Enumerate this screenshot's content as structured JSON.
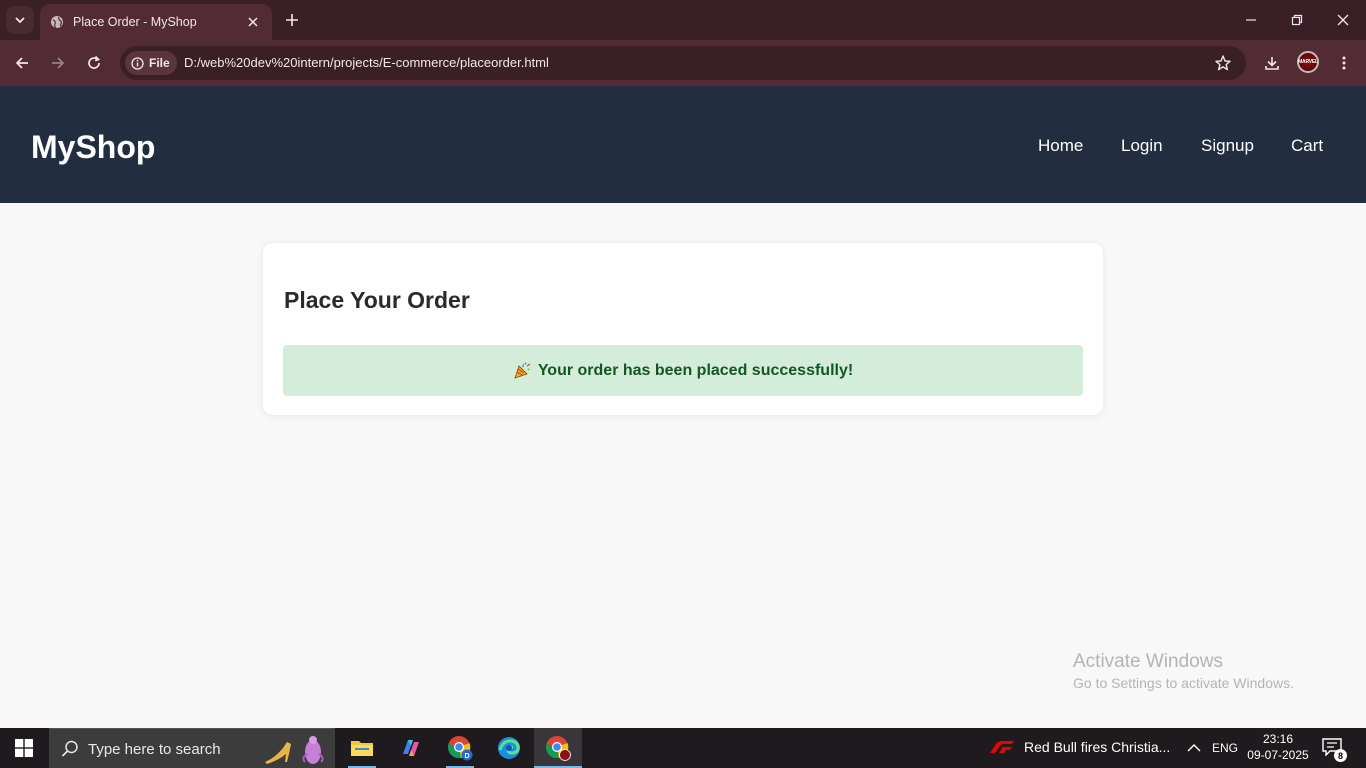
{
  "browser": {
    "tab_title": "Place Order - MyShop",
    "chip_label": "File",
    "url": "D:/web%20dev%20intern/projects/E-commerce/placeorder.html",
    "profile_label": "MARVEL"
  },
  "site": {
    "brand": "MyShop",
    "nav": [
      {
        "label": "Home"
      },
      {
        "label": "Login"
      },
      {
        "label": "Signup"
      },
      {
        "label": "Cart"
      }
    ]
  },
  "order": {
    "title": "Place Your Order",
    "success_icon": "party-popper-icon",
    "success_message": "Your order has been placed successfully!"
  },
  "watermark": {
    "title": "Activate Windows",
    "subtitle": "Go to Settings to activate Windows."
  },
  "taskbar": {
    "search_placeholder": "Type here to search",
    "apps": [
      "file-explorer",
      "copilot",
      "chrome-profile-d",
      "edge",
      "chrome-marvel"
    ],
    "news_headline": "Red Bull fires Christia...",
    "language": "ENG",
    "time": "23:16",
    "date": "09-07-2025",
    "notification_count": "8"
  },
  "colors": {
    "browser_frame": "#3a1f26",
    "browser_toolbar": "#522b34",
    "site_header": "#222e40",
    "page_background": "#f8f8f8",
    "alert_background": "#d4edda",
    "alert_text": "#155724"
  }
}
